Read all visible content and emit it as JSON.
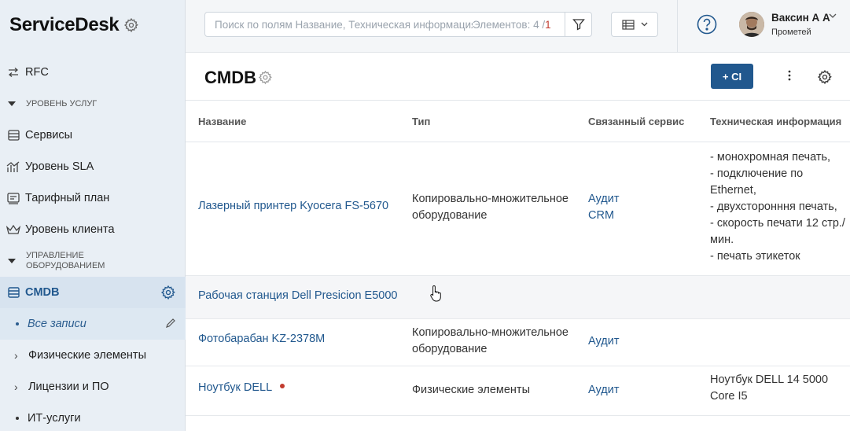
{
  "app": {
    "title": "ServiceDesk"
  },
  "sidebar": {
    "items": [
      {
        "label": "RFC"
      },
      {
        "label": "УРОВЕНЬ УСЛУГ"
      },
      {
        "label": "Сервисы"
      },
      {
        "label": "Уровень SLA"
      },
      {
        "label": "Тарифный план"
      },
      {
        "label": "Уровень клиента"
      },
      {
        "label": "УПРАВЛЕНИЕ ОБОРУДОВАНИЕМ"
      },
      {
        "label": "CMDB"
      },
      {
        "label": "Все записи"
      },
      {
        "label": "Физические элементы"
      },
      {
        "label": "Лицензии и ПО"
      },
      {
        "label": "ИТ-услуги"
      }
    ]
  },
  "topbar": {
    "search_placeholder": "Поиск по полям Название, Техническая информация",
    "count_label": "Элементов: 4 /",
    "count_red": "1",
    "user_name": "Ваксин А А",
    "user_org": "Прометей"
  },
  "page": {
    "title": "CMDB",
    "add_button": "+ CI"
  },
  "table": {
    "columns": [
      "Название",
      "Тип",
      "Связанный сервис",
      "Техническая информация"
    ],
    "rows": [
      {
        "name": "Лазерный принтер Kyocera FS-5670",
        "type": "Копировально-множительное оборудование",
        "services": [
          "Аудит",
          "CRM"
        ],
        "tech": [
          "- монохромная печать,",
          "- подключение по Ethernet,",
          "- двухсторонння печать,",
          "- скорость печати 12 стр./мин.",
          "- печать этикеток"
        ]
      },
      {
        "name": "Рабочая станция Dell Presicion E5000",
        "type": "",
        "services": [],
        "tech": []
      },
      {
        "name": "Фотобарабан KZ-2378M",
        "type": "Копировально-множительное оборудование",
        "services": [
          "Аудит"
        ],
        "tech": []
      },
      {
        "name": "Ноутбук DELL",
        "type": "Физические элементы",
        "services": [
          "Аудит"
        ],
        "tech": [
          "Ноутбук DELL 14 5000 Core I5"
        ]
      }
    ]
  },
  "colors": {
    "accent": "#21588e",
    "alert": "#c23b2e",
    "sidebar_bg": "#e9eff5"
  }
}
